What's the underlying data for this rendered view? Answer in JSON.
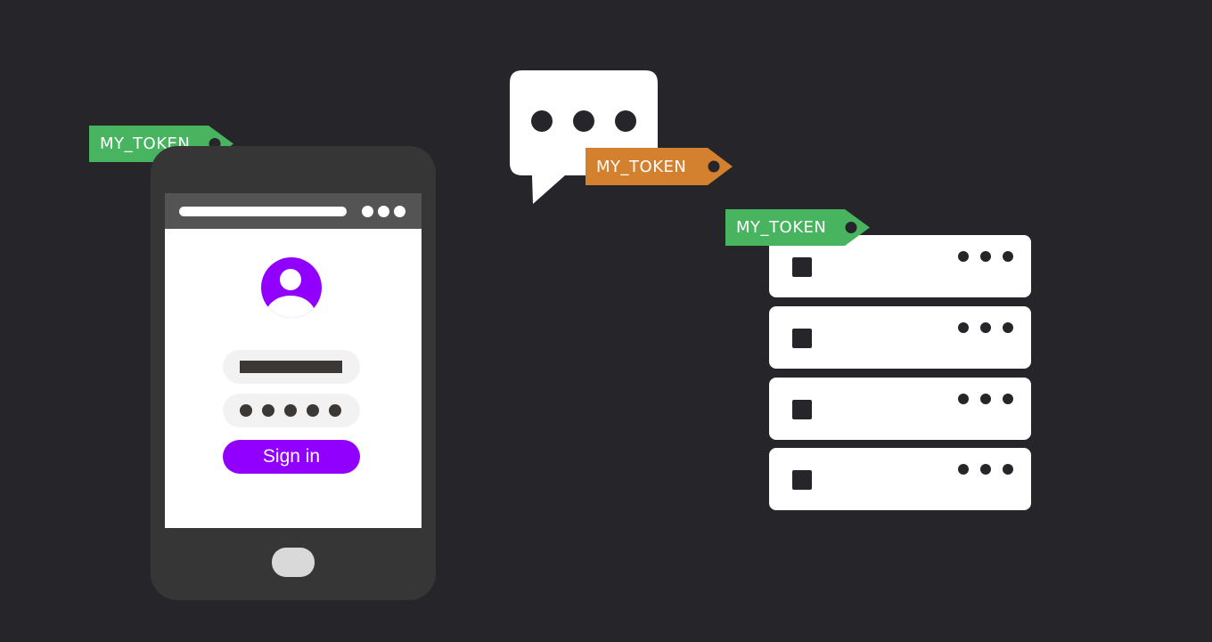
{
  "tags": {
    "phone": {
      "label": "MY_TOKEN",
      "color": "#48b45f"
    },
    "chat": {
      "label": "MY_TOKEN",
      "color": "#d3812f"
    },
    "server": {
      "label": "MY_TOKEN",
      "color": "#48b45f"
    }
  },
  "phone": {
    "sign_in_label": "Sign in",
    "password_mask_count": 5,
    "accent_color": "#9100ff"
  },
  "chat_bubble": {
    "dot_count": 3
  },
  "servers": {
    "unit_count": 4
  },
  "colors": {
    "background": "#26252a",
    "phone_body": "#363636",
    "browser_bar": "#545454"
  }
}
